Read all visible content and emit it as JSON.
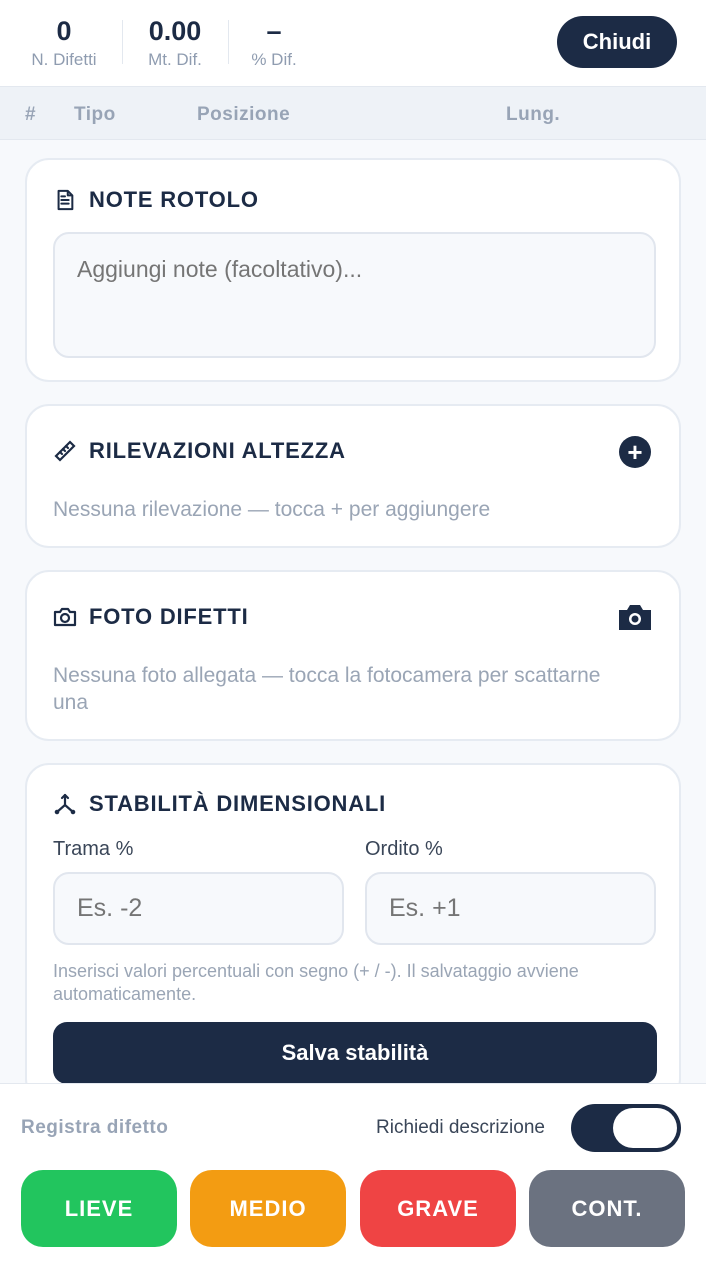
{
  "stats": [
    {
      "value": "0",
      "label": "N. Difetti"
    },
    {
      "value": "0.00",
      "label": "Mt. Dif."
    },
    {
      "value": "–",
      "label": "% Dif."
    }
  ],
  "header": {
    "close_label": "Chiudi"
  },
  "table_header": [
    "#",
    "Tipo",
    "Posizione",
    "Lung."
  ],
  "notes": {
    "title": "NOTE ROTOLO",
    "placeholder": "Aggiungi note (facoltativo)..."
  },
  "heights": {
    "title": "RILEVAZIONI ALTEZZA",
    "empty": "Nessuna rilevazione — tocca + per aggiungere",
    "add_label": "+"
  },
  "photos": {
    "title": "FOTO DIFETTI",
    "empty": "Nessuna foto allegata — tocca la fotocamera per scattarne una"
  },
  "stability": {
    "title": "STABILITÀ DIMENSIONALI",
    "weft_label": "Trama %",
    "weft_placeholder": "Es. -2",
    "warp_label": "Ordito %",
    "warp_placeholder": "Es. +1",
    "hint": "Inserisci valori percentuali con segno (+ / -). Il salvataggio avviene automaticamente.",
    "save_label": "Salva stabilità"
  },
  "bottom": {
    "register_label": "Registra difetto",
    "require_desc_label": "Richiedi descrizione",
    "require_desc_on": true,
    "severity": [
      {
        "label": "LIEVE",
        "color": "#22c55e"
      },
      {
        "label": "MEDIO",
        "color": "#f39c12"
      },
      {
        "label": "GRAVE",
        "color": "#ef4444"
      },
      {
        "label": "CONT.",
        "color": "#6b7280"
      }
    ]
  }
}
